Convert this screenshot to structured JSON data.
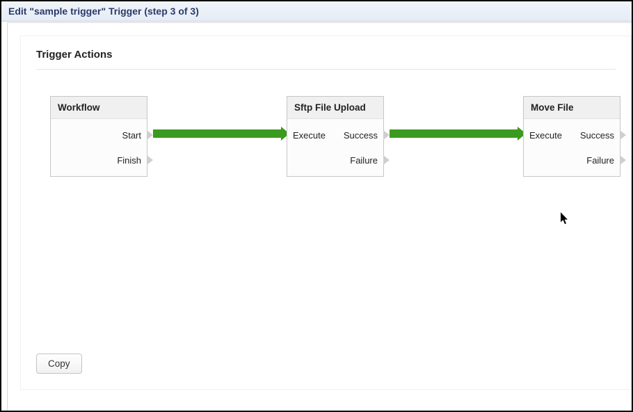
{
  "title": "Edit \"sample trigger\" Trigger (step 3 of 3)",
  "section_heading": "Trigger Actions",
  "copy_label": "Copy",
  "nodes": {
    "workflow": {
      "title": "Workflow",
      "port_left_1": "Start",
      "port_left_2": "Finish"
    },
    "sftp": {
      "title": "Sftp File Upload",
      "port_in": "Execute",
      "port_success": "Success",
      "port_failure": "Failure"
    },
    "move": {
      "title": "Move File",
      "port_in": "Execute",
      "port_success": "Success",
      "port_failure": "Failure"
    }
  }
}
